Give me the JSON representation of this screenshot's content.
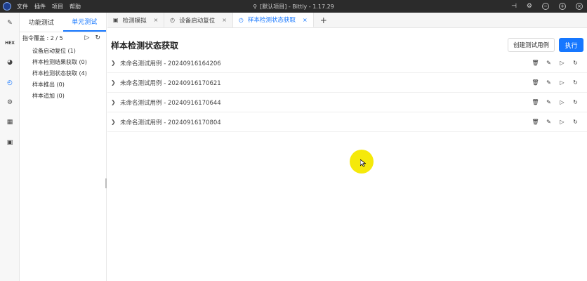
{
  "titlebar": {
    "menus": [
      "文件",
      "插件",
      "项目",
      "帮助"
    ],
    "title": "[默认项目] - Bittly - 1.17.29"
  },
  "sidepanel": {
    "tabs": [
      "功能测试",
      "单元测试"
    ],
    "coverage": "指令覆盖 : 2 / 5",
    "items": [
      "设备启动复位 (1)",
      "样本检测结果获取 (0)",
      "样本检测状态获取 (4)",
      "样本推出 (0)",
      "样本追加 (0)"
    ]
  },
  "tabs": [
    {
      "label": "检测模拟"
    },
    {
      "label": "设备启动复位"
    },
    {
      "label": "样本检测状态获取"
    }
  ],
  "content": {
    "title": "样本检测状态获取",
    "create_label": "创建测试用例",
    "exec_label": "执行",
    "cases": [
      "未命名测试用例 - 20240916164206",
      "未命名测试用例 - 20240916170621",
      "未命名测试用例 - 20240916170644",
      "未命名测试用例 - 20240916170804"
    ]
  },
  "colors": {
    "accent": "#1677ff",
    "titlebar": "#2b2b2b",
    "cursor_highlight": "#f5e90a"
  }
}
